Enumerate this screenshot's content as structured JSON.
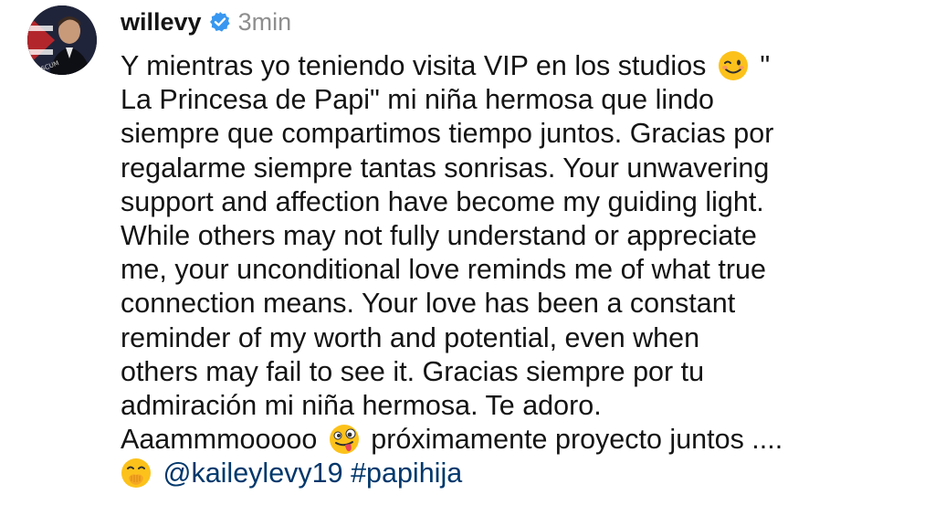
{
  "post": {
    "username": "willevy",
    "verified": true,
    "time": "3min",
    "avatar": {
      "icon": "profile-photo",
      "watermark_text": "NOSCUM",
      "colors": [
        "#b2262b",
        "#1b2a52",
        "#ffffff"
      ]
    },
    "caption": {
      "lines": [
        {
          "a": "Y mientras yo teniendo visita  VIP en los studios ",
          "emoji": "winking-face-emoji",
          "b": " \""
        },
        {
          "text": "La Princesa de Papi\" mi niña hermosa que lindo"
        },
        {
          "text": "siempre que compartimos tiempo juntos. Gracias por"
        },
        {
          "text": "regalarme siempre tantas sonrisas. Your unwavering"
        },
        {
          "text": "support and affection have become my guiding light."
        },
        {
          "text": "While others may not fully understand or appreciate"
        },
        {
          "text": "me, your unconditional love reminds me of what true"
        },
        {
          "text": "connection means. Your love has been a constant"
        },
        {
          "text": "reminder of my worth and potential, even when"
        },
        {
          "text": "others may fail to see it. Gracias siempre por tu"
        },
        {
          "text": "admiración mi niña hermosa. Te adoro."
        },
        {
          "a": "Aaammmooooo ",
          "emoji": "zany-face-emoji",
          "b": " próximamente proyecto juntos ...."
        }
      ],
      "final_emoji": "face-with-hand-over-mouth-emoji",
      "mention": "@kaileylevy19",
      "hashtag": "#papihija"
    },
    "colors": {
      "text": "#141414",
      "secondary": "#8e8e8e",
      "link": "#00376b",
      "verified": "#3897f0"
    }
  }
}
